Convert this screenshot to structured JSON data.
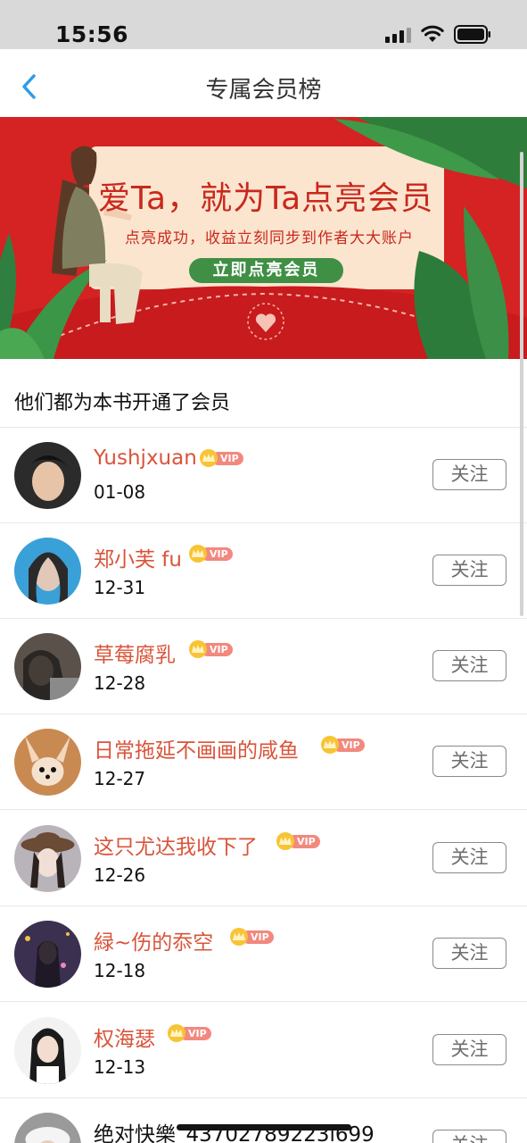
{
  "status_bar": {
    "time": "15:56"
  },
  "nav": {
    "title": "专属会员榜"
  },
  "banner": {
    "title": "爱Ta，就为Ta点亮会员",
    "subtitle": "点亮成功，收益立刻同步到作者大大账户",
    "button_label": "立即点亮会员"
  },
  "section": {
    "title": "他们都为本书开通了会员"
  },
  "vip_label": "VIP",
  "follow_label": "关注",
  "members": [
    {
      "name": "Yushjxuan",
      "date": "01-08"
    },
    {
      "name": "郑小芙 fu",
      "date": "12-31"
    },
    {
      "name": "草莓腐乳",
      "date": "12-28"
    },
    {
      "name": "日常拖延不画画的咸鱼",
      "date": "12-27"
    },
    {
      "name": "这只尤达我收下了",
      "date": "12-26"
    },
    {
      "name": "緑~伤的忝空",
      "date": "12-18"
    },
    {
      "name": "权海瑟",
      "date": "12-13"
    },
    {
      "name": "绝对快樂_43702789223l699",
      "date": ""
    }
  ],
  "colors": {
    "accent_blue": "#2f9de4",
    "name_red": "#d9543a",
    "banner_red": "#cf1d1f",
    "vip_pill": "#f2887e",
    "vip_crown": "#f7c435",
    "banner_button": "#3f8f45"
  }
}
